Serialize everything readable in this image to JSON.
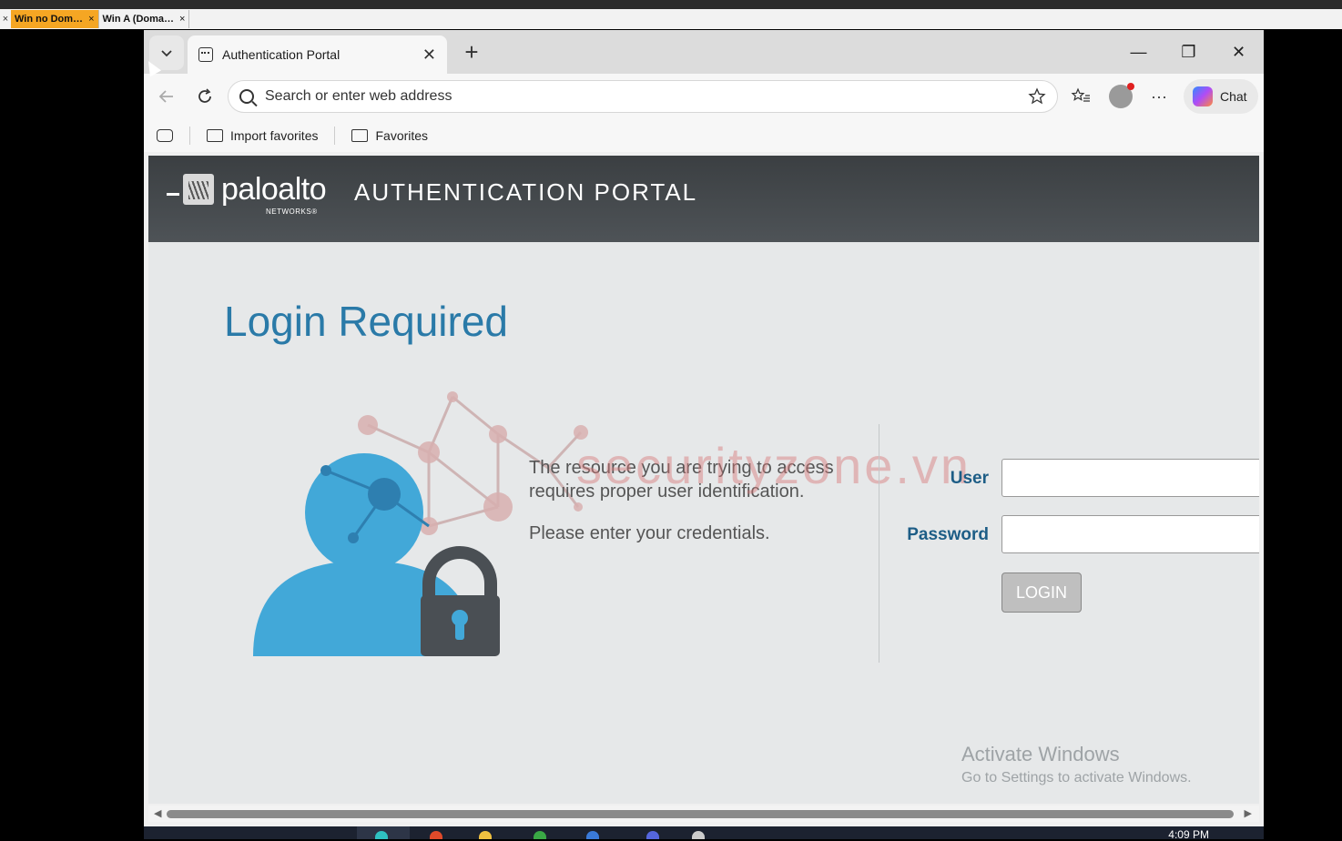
{
  "vm": {
    "close_glyph": "×",
    "tabs": [
      {
        "label": "Win no Dom…",
        "close": "×"
      },
      {
        "label": "Win A (Doma…",
        "close": "×"
      }
    ]
  },
  "browser": {
    "tab_title": "Authentication Portal",
    "tab_close": "✕",
    "new_tab": "+",
    "window_controls": {
      "minimize": "—",
      "restore": "❐",
      "close": "✕"
    },
    "address_placeholder": "Search or enter web address",
    "chat_label": "Chat",
    "favorites": [
      {
        "label": "Import favorites",
        "icon": "import-icon"
      },
      {
        "label": "Favorites",
        "icon": "folder-icon"
      }
    ],
    "more_glyph": "···"
  },
  "page": {
    "brand": "paloalto",
    "brand_sub": "NETWORKS®",
    "portal_title": "AUTHENTICATION PORTAL",
    "heading": "Login Required",
    "message_line1": "The resource you are trying to access requires proper user identification.",
    "message_line2": "Please enter your credentials.",
    "user_label": "User",
    "password_label": "Password",
    "login_button": "LOGIN",
    "watermark": "securityzone.vn"
  },
  "os": {
    "activate_title": "Activate Windows",
    "activate_sub": "Go to Settings to activate Windows.",
    "clock": "4:09 PM"
  },
  "colors": {
    "accent_vm_tab": "#f5a623",
    "banner": "#3b3f42",
    "heading": "#2a7aa8",
    "label": "#1d5d86",
    "person_blue": "#42a8d8",
    "lock_grey": "#4a4f54"
  }
}
